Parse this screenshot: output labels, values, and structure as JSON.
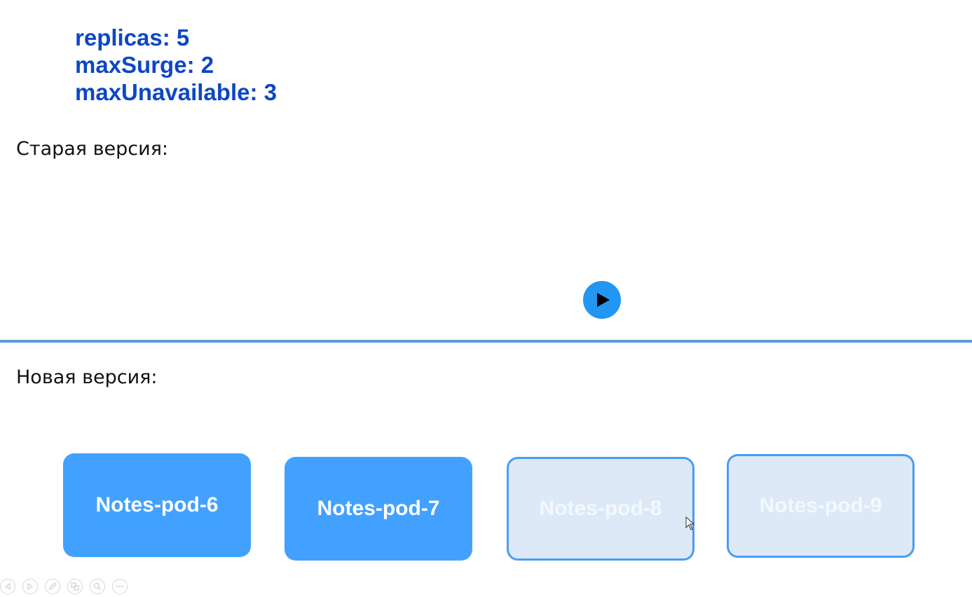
{
  "params": {
    "replicas": "replicas: 5",
    "max_surge": "maxSurge: 2",
    "max_unavailable": "maxUnavailable: 3"
  },
  "old_version": {
    "label": "Старая версия:"
  },
  "new_version": {
    "label": "Новая версия:"
  },
  "pods": [
    {
      "label": "Notes-pod-6",
      "state": "ready"
    },
    {
      "label": "Notes-pod-7",
      "state": "ready"
    },
    {
      "label": "Notes-pod-8",
      "state": "pending"
    },
    {
      "label": "Notes-pod-9",
      "state": "pending"
    }
  ],
  "play_button": {
    "icon": "play-icon"
  },
  "toolbar": {
    "icons": [
      "previous-icon",
      "next-icon",
      "pen-icon",
      "slides-icon",
      "zoom-icon",
      "more-icon"
    ]
  },
  "colors": {
    "params_text": "#0d47c4",
    "pod_ready": "#42a1ff",
    "pod_pending_fill": "#dde9f7",
    "pod_pending_border": "#4a9cf5",
    "divider": "#5b9bd5",
    "play_button": "#2196f3"
  }
}
